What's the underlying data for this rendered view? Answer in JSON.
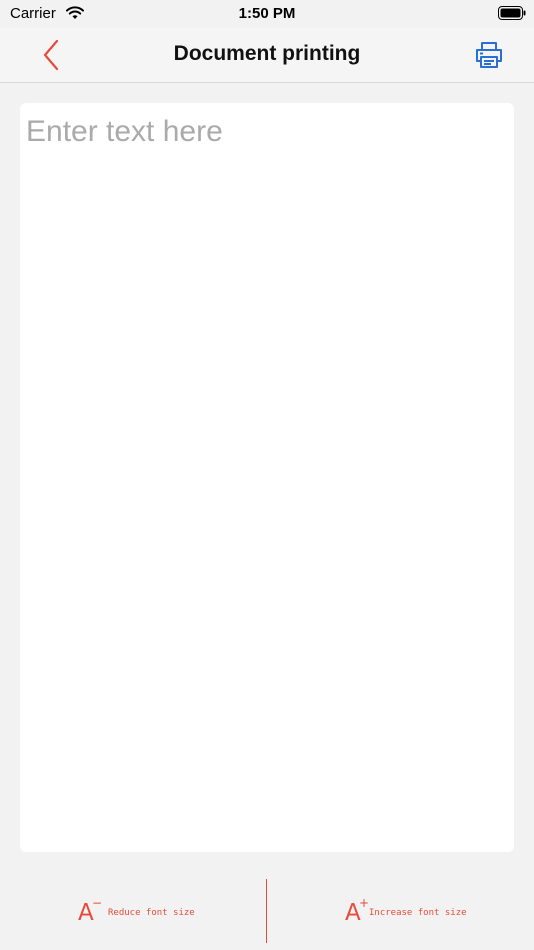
{
  "status_bar": {
    "carrier": "Carrier",
    "time": "1:50 PM"
  },
  "nav": {
    "title": "Document printing",
    "back_icon": "chevron-left-icon",
    "print_icon": "printer-icon"
  },
  "editor": {
    "placeholder": "Enter text here",
    "value": ""
  },
  "toolbar": {
    "reduce": {
      "glyph": "A",
      "sign": "−",
      "label": "Reduce font size"
    },
    "increase": {
      "glyph": "A",
      "sign": "+",
      "label": "Increase font size"
    }
  },
  "colors": {
    "accent": "#e74b3c",
    "print_icon": "#2a6fd6",
    "background": "#f2f2f2"
  }
}
